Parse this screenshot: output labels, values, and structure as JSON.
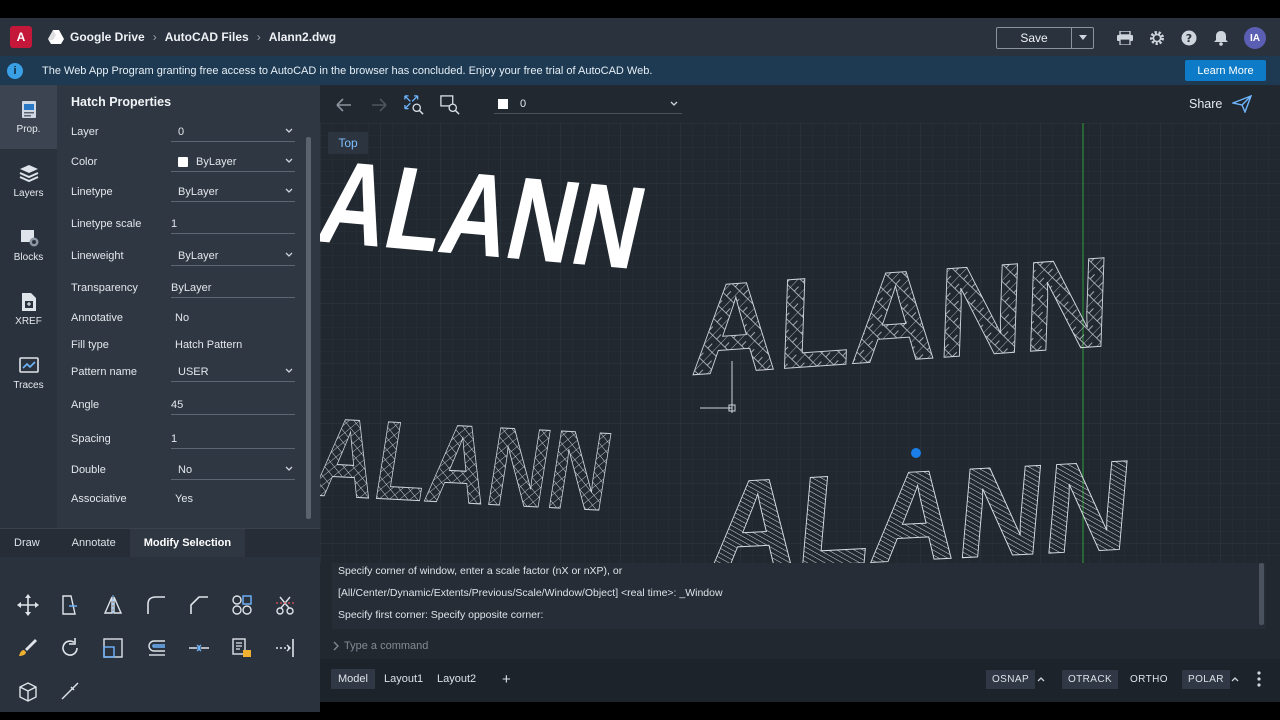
{
  "app": {
    "logo_letter": "A",
    "breadcrumb": [
      "Google Drive",
      "AutoCAD Files",
      "Alann2.dwg"
    ],
    "save_label": "Save",
    "avatar_initials": "IA"
  },
  "banner": {
    "text": "The Web App Program granting free access to AutoCAD in the browser has concluded. Enjoy your free trial of AutoCAD Web.",
    "button": "Learn More"
  },
  "rail": [
    {
      "label": "Prop.",
      "icon": "properties-icon"
    },
    {
      "label": "Layers",
      "icon": "layers-icon"
    },
    {
      "label": "Blocks",
      "icon": "blocks-icon"
    },
    {
      "label": "XREF",
      "icon": "xref-icon"
    },
    {
      "label": "Traces",
      "icon": "traces-icon"
    }
  ],
  "properties": {
    "title": "Hatch Properties",
    "rows": [
      {
        "label": "Layer",
        "value": "0"
      },
      {
        "label": "Color",
        "value": "ByLayer"
      },
      {
        "label": "Linetype",
        "value": "ByLayer"
      },
      {
        "label": "Linetype scale",
        "value": "1"
      },
      {
        "label": "Lineweight",
        "value": "ByLayer"
      },
      {
        "label": "Transparency",
        "value": "ByLayer"
      },
      {
        "label": "Annotative",
        "value": "No"
      },
      {
        "label": "Fill type",
        "value": "Hatch Pattern"
      },
      {
        "label": "Pattern name",
        "value": "USER"
      },
      {
        "label": "Angle",
        "value": "45"
      },
      {
        "label": "Spacing",
        "value": "1"
      },
      {
        "label": "Double",
        "value": "No"
      },
      {
        "label": "Associative",
        "value": "Yes"
      }
    ]
  },
  "tool_tabs": [
    "Draw",
    "Annotate",
    "Modify Selection"
  ],
  "canvas": {
    "layer_value": "0",
    "share_label": "Share",
    "view_label": "Top",
    "drawing_text": "ALANN"
  },
  "command": {
    "history": [
      "Specify corner of window, enter a scale factor (nX or nXP), or",
      "[All/Center/Dynamic/Extents/Previous/Scale/Window/Object] <real time>: _Window",
      "Specify first corner: Specify opposite corner:"
    ],
    "placeholder": "Type a command"
  },
  "layouts": [
    "Model",
    "Layout1",
    "Layout2"
  ],
  "status_buttons": [
    "OSNAP",
    "OTRACK",
    "ORTHO",
    "POLAR"
  ],
  "colors": {
    "accent": "#0d7bc7",
    "brand": "#c4173a",
    "ucs_green": "#2e8b3a"
  }
}
